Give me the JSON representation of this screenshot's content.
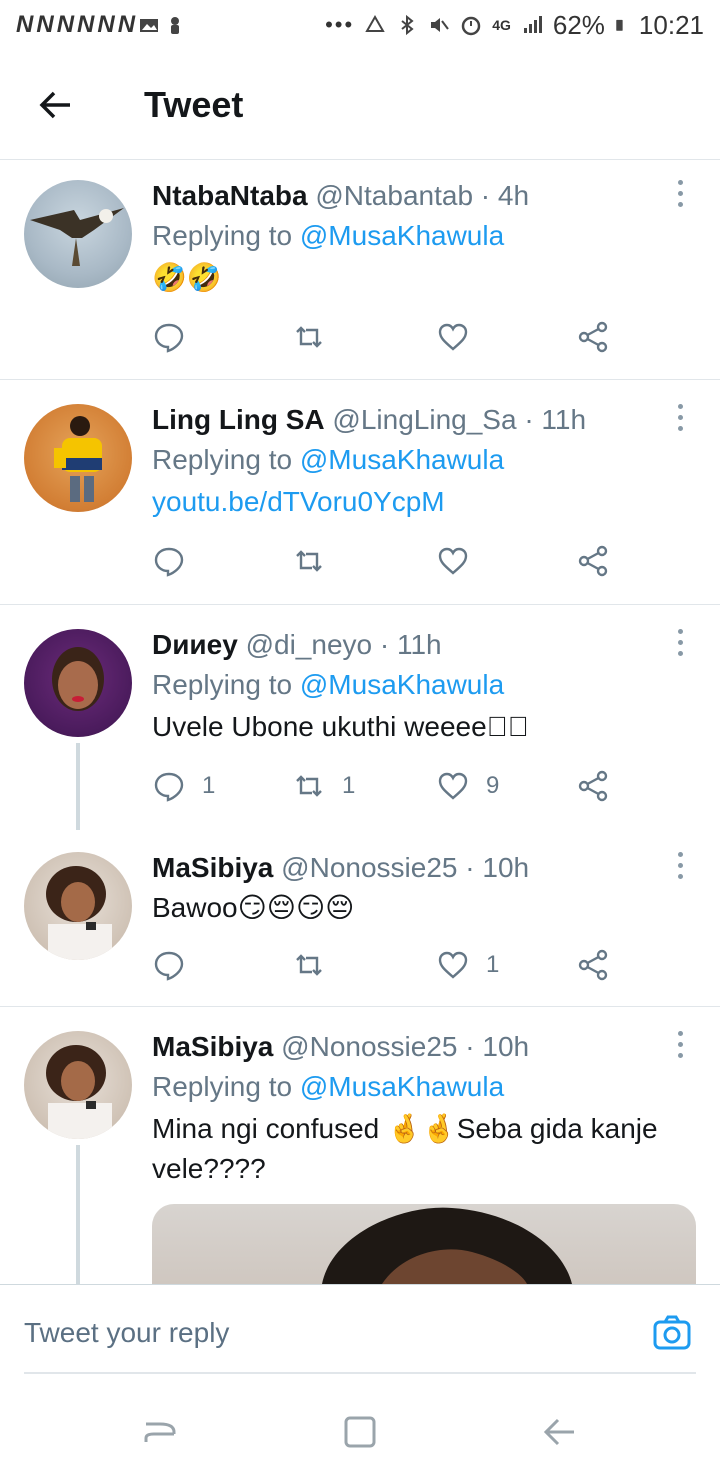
{
  "statusbar": {
    "left_icons": [
      "N",
      "N",
      "N",
      "N",
      "N",
      "N"
    ],
    "battery": "62%",
    "time": "10:21",
    "network": "4G"
  },
  "header": {
    "title": "Tweet"
  },
  "tweets": [
    {
      "name": "NtabaNtaba",
      "handle": "@Ntabantab",
      "time": "· 4h",
      "replying_label": "Replying to ",
      "replying_to": "@MusaKhawula",
      "text": "🤣🤣",
      "link": "",
      "reply_count": "",
      "retweet_count": "",
      "like_count": ""
    },
    {
      "name": "Ling Ling SA",
      "handle": "@LingLing_Sa",
      "time": "· 11h",
      "replying_label": "Replying to ",
      "replying_to": "@MusaKhawula",
      "text": "",
      "link": "youtu.be/dTVoru0YcpM",
      "reply_count": "",
      "retweet_count": "",
      "like_count": ""
    },
    {
      "name": "Dииey",
      "handle": "@di_neyo",
      "time": "· 11h",
      "replying_label": "Replying to ",
      "replying_to": "@MusaKhawula",
      "text": "Uvele Ubone ukuthi weeee\u0000\u0000",
      "link": "",
      "reply_count": "1",
      "retweet_count": "1",
      "like_count": "9"
    },
    {
      "name": "MaSibiya",
      "handle": "@Nonossie25",
      "time": "· 10h",
      "replying_label": "",
      "replying_to": "",
      "text": "Bawoo😏😔😏😔",
      "link": "",
      "reply_count": "",
      "retweet_count": "",
      "like_count": "1"
    },
    {
      "name": "MaSibiya",
      "handle": "@Nonossie25",
      "time": "· 10h",
      "replying_label": "Replying to ",
      "replying_to": "@MusaKhawula",
      "text": "Mina ngi confused 🤞🤞Seba gida kanje vele????",
      "link": "",
      "reply_count": "",
      "retweet_count": "",
      "like_count": ""
    }
  ],
  "composer": {
    "placeholder": "Tweet your reply"
  },
  "colors": {
    "accent": "#1d9bf0",
    "muted": "#657786",
    "divider": "#e1e6ea"
  },
  "icons": [
    "back-arrow-icon",
    "reply-icon",
    "retweet-icon",
    "like-icon",
    "share-icon",
    "more-icon",
    "camera-icon",
    "recents-icon",
    "home-icon",
    "back-icon"
  ]
}
